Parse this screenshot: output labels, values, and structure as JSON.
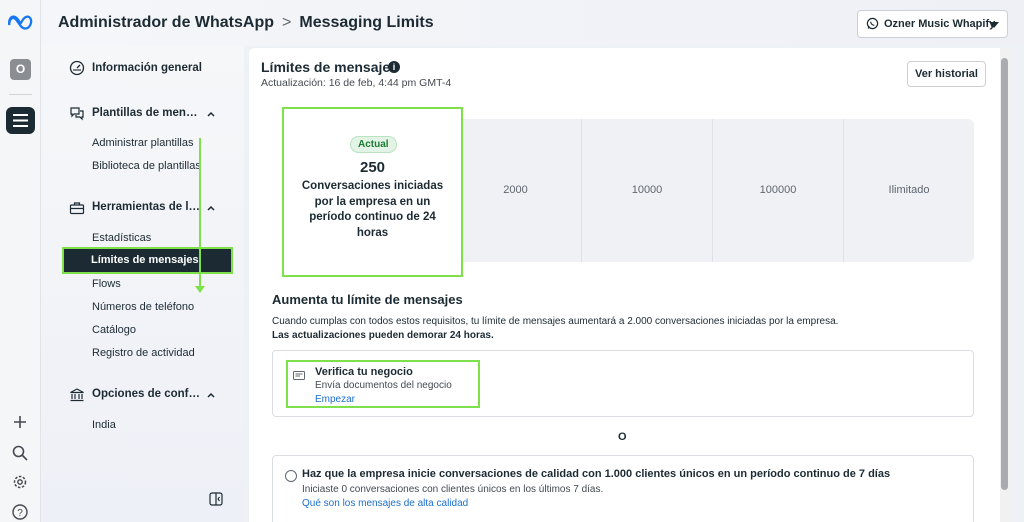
{
  "header": {
    "breadcrumb_root": "Administrador de WhatsApp",
    "breadcrumb_sep": ">",
    "breadcrumb_current": "Messaging Limits",
    "account_name": "Ozner Music Whapify"
  },
  "rail": {
    "avatar_letter": "O"
  },
  "sidebar": {
    "overview": "Información general",
    "templates": {
      "title": "Plantillas de men…",
      "items": [
        "Administrar plantillas",
        "Biblioteca de plantillas"
      ]
    },
    "tools": {
      "title": "Herramientas de l…",
      "items": [
        "Estadísticas",
        "Límites de mensajes",
        "Flows",
        "Números de teléfono",
        "Catálogo",
        "Registro de actividad"
      ]
    },
    "settings": {
      "title": "Opciones de conf…",
      "items": [
        "India"
      ]
    }
  },
  "main": {
    "title": "Límites de mensajes",
    "updated": "Actualización: 16 de feb, 4:44 pm GMT-4",
    "history_button": "Ver historial",
    "current_badge": "Actual",
    "current_value": "250",
    "current_desc": "Conversaciones iniciadas por la empresa en un período continuo de 24 horas",
    "tiers": [
      "2000",
      "10000",
      "100000",
      "Ilimitado"
    ],
    "increase_title": "Aumenta tu límite de mensajes",
    "increase_text": "Cuando cumplas con todos estos requisitos, tu límite de mensajes aumentará a 2.000 conversaciones iniciadas por la empresa.",
    "increase_note": "Las actualizaciones pueden demorar 24 horas.",
    "verify": {
      "title": "Verifica tu negocio",
      "subtitle": "Envía documentos del negocio",
      "link": "Empezar"
    },
    "or_label": "O",
    "quality": {
      "title": "Haz que la empresa inicie conversaciones de calidad con 1.000 clientes únicos en un período continuo de 7 días",
      "subtitle": "Iniciaste 0 conversaciones con clientes únicos en los últimos 7 días.",
      "link": "Qué son los mensajes de alta calidad"
    }
  },
  "colors": {
    "highlight": "#7ee04a",
    "active_bg": "#1c2b33",
    "link": "#1d6fce"
  }
}
